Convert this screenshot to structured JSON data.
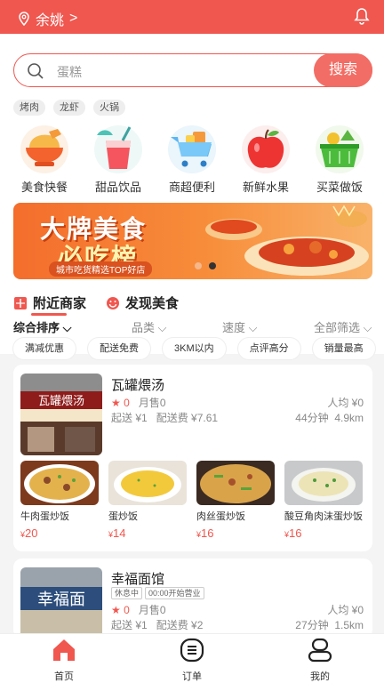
{
  "location": {
    "city": "余姚",
    "chevron": ">"
  },
  "search": {
    "placeholder": "蛋糕",
    "button_label": "搜索"
  },
  "hot_tags": [
    "烤肉",
    "龙虾",
    "火锅"
  ],
  "categories": [
    {
      "label": "美食快餐",
      "icon": "rice-bowl-icon"
    },
    {
      "label": "甜品饮品",
      "icon": "drink-cup-icon"
    },
    {
      "label": "商超便利",
      "icon": "shopping-cart-icon"
    },
    {
      "label": "新鲜水果",
      "icon": "apple-icon"
    },
    {
      "label": "买菜做饭",
      "icon": "vegetable-basket-icon"
    }
  ],
  "banner": {
    "title_line1": "大牌美食",
    "title_line2": "必吃榜",
    "subtitle": "城市吃货精选TOP好店",
    "slide_index": 2,
    "slide_count": 2
  },
  "sections": {
    "nearby": "附近商家",
    "discover": "发现美食"
  },
  "filters": {
    "sort": "综合排序",
    "category": "品类",
    "speed": "速度",
    "all": "全部筛选"
  },
  "chips": [
    "满减优惠",
    "配送免费",
    "3KM以内",
    "点评高分",
    "销量最高"
  ],
  "stores": [
    {
      "name": "瓦罐煨汤",
      "rating": "0",
      "monthly_sales": "月售0",
      "avg_price": "人均 ¥0",
      "min_order": "起送 ¥1",
      "delivery_fee": "配送费 ¥7.61",
      "time": "44分钟",
      "distance": "4.9km",
      "sign_text": "瓦罐煨汤",
      "dishes": [
        {
          "name": "牛肉蛋炒饭",
          "currency": "¥",
          "price": "20"
        },
        {
          "name": "蛋炒饭",
          "currency": "¥",
          "price": "14"
        },
        {
          "name": "肉丝蛋炒饭",
          "currency": "¥",
          "price": "16"
        },
        {
          "name": "酸豆角肉沫蛋炒饭",
          "currency": "¥",
          "price": "16"
        }
      ]
    },
    {
      "name": "幸福面馆",
      "status": "休息中",
      "open_time": "00:00开始营业",
      "rating": "0",
      "monthly_sales": "月售0",
      "avg_price": "人均 ¥0",
      "min_order": "起送 ¥1",
      "delivery_fee": "配送费 ¥2",
      "time": "27分钟",
      "distance": "1.5km",
      "sign_text": "幸福面"
    }
  ],
  "tabbar": [
    {
      "label": "首页",
      "icon": "home-icon",
      "active": true
    },
    {
      "label": "订单",
      "icon": "order-list-icon",
      "active": false
    },
    {
      "label": "我的",
      "icon": "profile-icon",
      "active": false
    }
  ],
  "colors": {
    "brand": "#f0574f",
    "search_button": "#f26d65",
    "price": "#f0574f"
  }
}
